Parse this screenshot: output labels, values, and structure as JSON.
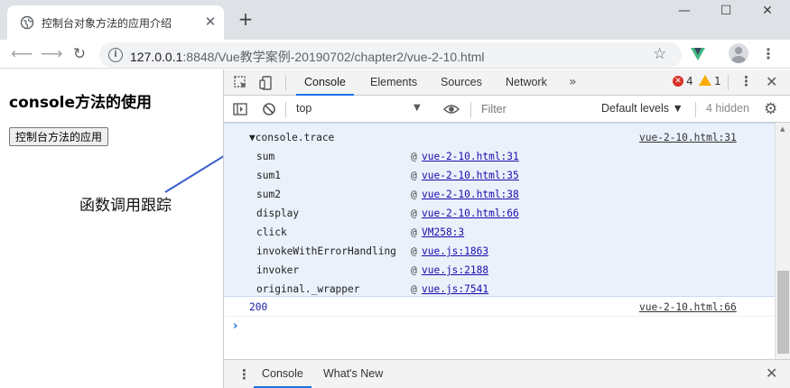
{
  "browser": {
    "tab_title": "控制台对象方法的应用介绍",
    "close_glyph": "✕",
    "new_tab_glyph": "+",
    "window_controls": {
      "minimize": "—",
      "maximize": "☐",
      "close": "✕"
    },
    "url_host": "127.0.0.1",
    "url_rest": ":8848/Vue教学案例-20190702/chapter2/vue-2-10.html",
    "icons": [
      "back-arrow-icon",
      "forward-arrow-icon",
      "reload-icon",
      "info-icon",
      "star-icon",
      "vue-devtools-icon",
      "avatar-icon",
      "menu-kebab-icon"
    ]
  },
  "page": {
    "heading": "console方法的使用",
    "button_label": "控制台方法的应用",
    "annotation": "函数调用跟踪"
  },
  "devtools": {
    "tabs": [
      "Console",
      "Elements",
      "Sources",
      "Network"
    ],
    "active_tab": "Console",
    "more_glyph": "»",
    "error_count": "4",
    "warning_count": "1",
    "context": "top",
    "filter_placeholder": "Filter",
    "levels": "Default levels ▼",
    "hidden": "4 hidden",
    "trace": {
      "label": "▼console.trace",
      "source": "vue-2-10.html:31",
      "frames": [
        {
          "fn": "sum",
          "at": "@",
          "link": "vue-2-10.html:31"
        },
        {
          "fn": "sum1",
          "at": "@",
          "link": "vue-2-10.html:35"
        },
        {
          "fn": "sum2",
          "at": "@",
          "link": "vue-2-10.html:38"
        },
        {
          "fn": "display",
          "at": "@",
          "link": "vue-2-10.html:66"
        },
        {
          "fn": "click",
          "at": "@",
          "link": "VM258:3"
        },
        {
          "fn": "invokeWithErrorHandling",
          "at": "@",
          "link": "vue.js:1863"
        },
        {
          "fn": "invoker",
          "at": "@",
          "link": "vue.js:2188"
        },
        {
          "fn": "original._wrapper",
          "at": "@",
          "link": "vue.js:7541"
        }
      ]
    },
    "log": {
      "value": "200",
      "source": "vue-2-10.html:66"
    },
    "prompt": "›",
    "drawer_tabs": [
      "Console",
      "What's New"
    ]
  },
  "colors": {
    "accent": "#1a73e8",
    "error": "#d93025",
    "warning": "#f9ab00",
    "trace_bg": "#eaf1fb",
    "link": "#1a0dab",
    "annotation_arrow": "#3a5fcd"
  }
}
